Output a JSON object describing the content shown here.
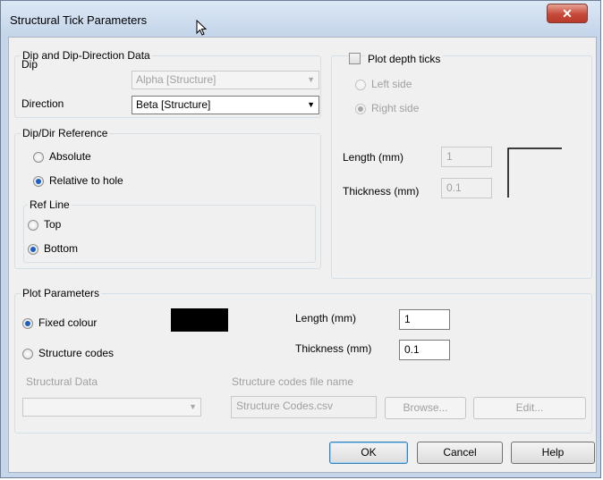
{
  "window": {
    "title": "Structural Tick Parameters",
    "close_glyph": "✕"
  },
  "dip_group": {
    "legend": "Dip and Dip-Direction Data",
    "dip_label": "Dip",
    "dip_value": "Alpha [Structure]",
    "direction_label": "Direction",
    "direction_value": "Beta [Structure]"
  },
  "reference_group": {
    "legend": "Dip/Dir Reference",
    "absolute_label": "Absolute",
    "relative_label": "Relative to hole",
    "selected": "Relative to hole",
    "ref_line": {
      "legend": "Ref Line",
      "top_label": "Top",
      "bottom_label": "Bottom",
      "selected": "Bottom"
    }
  },
  "depth_ticks": {
    "checkbox_label": "Plot depth ticks",
    "checked": false,
    "left_label": "Left side",
    "right_label": "Right side",
    "selected": "Right side",
    "length_label": "Length (mm)",
    "length_value": "1",
    "thickness_label": "Thickness (mm)",
    "thickness_value": "0.1"
  },
  "plot_params": {
    "legend": "Plot Parameters",
    "fixed_colour_label": "Fixed colour",
    "structure_codes_label": "Structure codes",
    "selected": "Fixed colour",
    "colour": "#000000",
    "length_label": "Length (mm)",
    "length_value": "1",
    "thickness_label": "Thickness (mm)",
    "thickness_value": "0.1",
    "structural_data_label": "Structural Data",
    "structural_data_value": "",
    "codes_file_label": "Structure codes file name",
    "codes_file_value": "Structure Codes.csv",
    "browse_label": "Browse...",
    "edit_label": "Edit..."
  },
  "buttons": {
    "ok": "OK",
    "cancel": "Cancel",
    "help": "Help"
  }
}
